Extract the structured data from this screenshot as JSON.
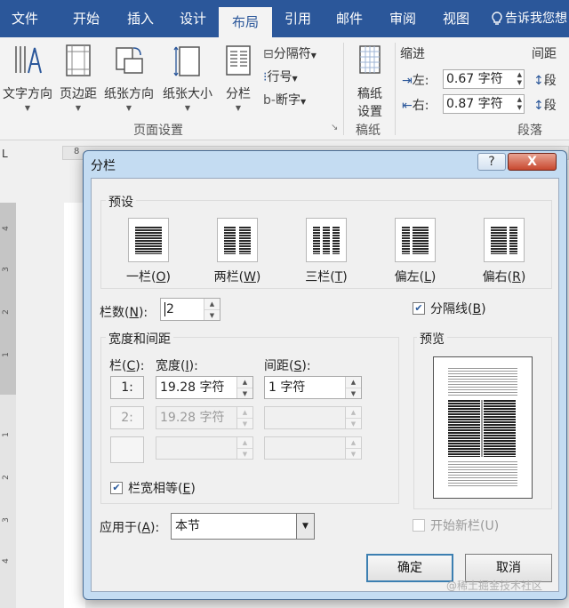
{
  "tabs": [
    "文件",
    "开始",
    "插入",
    "设计",
    "布局",
    "引用",
    "邮件",
    "审阅",
    "视图"
  ],
  "active_tab": "布局",
  "tell_me": "告诉我您想",
  "ribbon": {
    "text_direction": "文字方向",
    "margins": "页边距",
    "orientation": "纸张方向",
    "size": "纸张大小",
    "columns": "分栏",
    "breaks": "分隔符",
    "line_numbers": "行号",
    "hyphenation": "断字",
    "page_setup_group": "页面设置",
    "draft_paper": "稿纸\n设置",
    "draft_line1": "稿纸",
    "draft_line2": "设置",
    "draft_group": "稿纸",
    "indent_title": "缩进",
    "indent_left_label": "左:",
    "indent_left_value": "0.67 字符",
    "indent_right_label": "右:",
    "indent_right_value": "0.87 字符",
    "spacing_title": "间距",
    "spacing_before": "段",
    "spacing_after": "段",
    "paragraph_group": "段落"
  },
  "ruler": {
    "corner": "L",
    "h_mark": "8",
    "v_numbers": [
      "4",
      "3",
      "2",
      "1",
      "1",
      "1",
      "2",
      "3",
      "4"
    ]
  },
  "dialog": {
    "title": "分栏",
    "help_label": "?",
    "close_label": "X",
    "presets_title": "预设",
    "presets": [
      {
        "label": "一栏",
        "key": "O"
      },
      {
        "label": "两栏",
        "key": "W"
      },
      {
        "label": "三栏",
        "key": "T"
      },
      {
        "label": "偏左",
        "key": "L"
      },
      {
        "label": "偏右",
        "key": "R"
      }
    ],
    "num_columns_label": "栏数(",
    "num_columns_key": "N",
    "num_columns_suffix": "):",
    "num_columns_value": "2",
    "line_between_label": "分隔线(",
    "line_between_key": "B",
    "line_between_suffix": ")",
    "line_between_checked": true,
    "width_spacing_title": "宽度和间距",
    "col_header": "栏(",
    "col_header_key": "C",
    "width_header": "宽度(",
    "width_header_key": "I",
    "spacing_header": "间距(",
    "spacing_header_key": "S",
    "header_suffix": "):",
    "rows": [
      {
        "col": "1:",
        "width": "19.28 字符",
        "spacing": "1 字符"
      },
      {
        "col": "2:",
        "width": "19.28 字符",
        "spacing": ""
      },
      {
        "col": "",
        "width": "",
        "spacing": ""
      }
    ],
    "equal_width_label": "栏宽相等(",
    "equal_width_key": "E",
    "equal_width_suffix": ")",
    "equal_width_checked": true,
    "apply_to_label": "应用于(",
    "apply_to_key": "A",
    "apply_to_suffix": "):",
    "apply_to_value": "本节",
    "preview_title": "预览",
    "start_new_column_label": "开始新栏(U)",
    "start_new_column_checked": false,
    "ok_label": "确定",
    "cancel_label": "取消"
  },
  "watermark": "@稀土掘金技术社区",
  "colors": {
    "ribbon_blue": "#2b579a",
    "dialog_frame": "#c4dcf2",
    "close_red": "#c8482f"
  }
}
